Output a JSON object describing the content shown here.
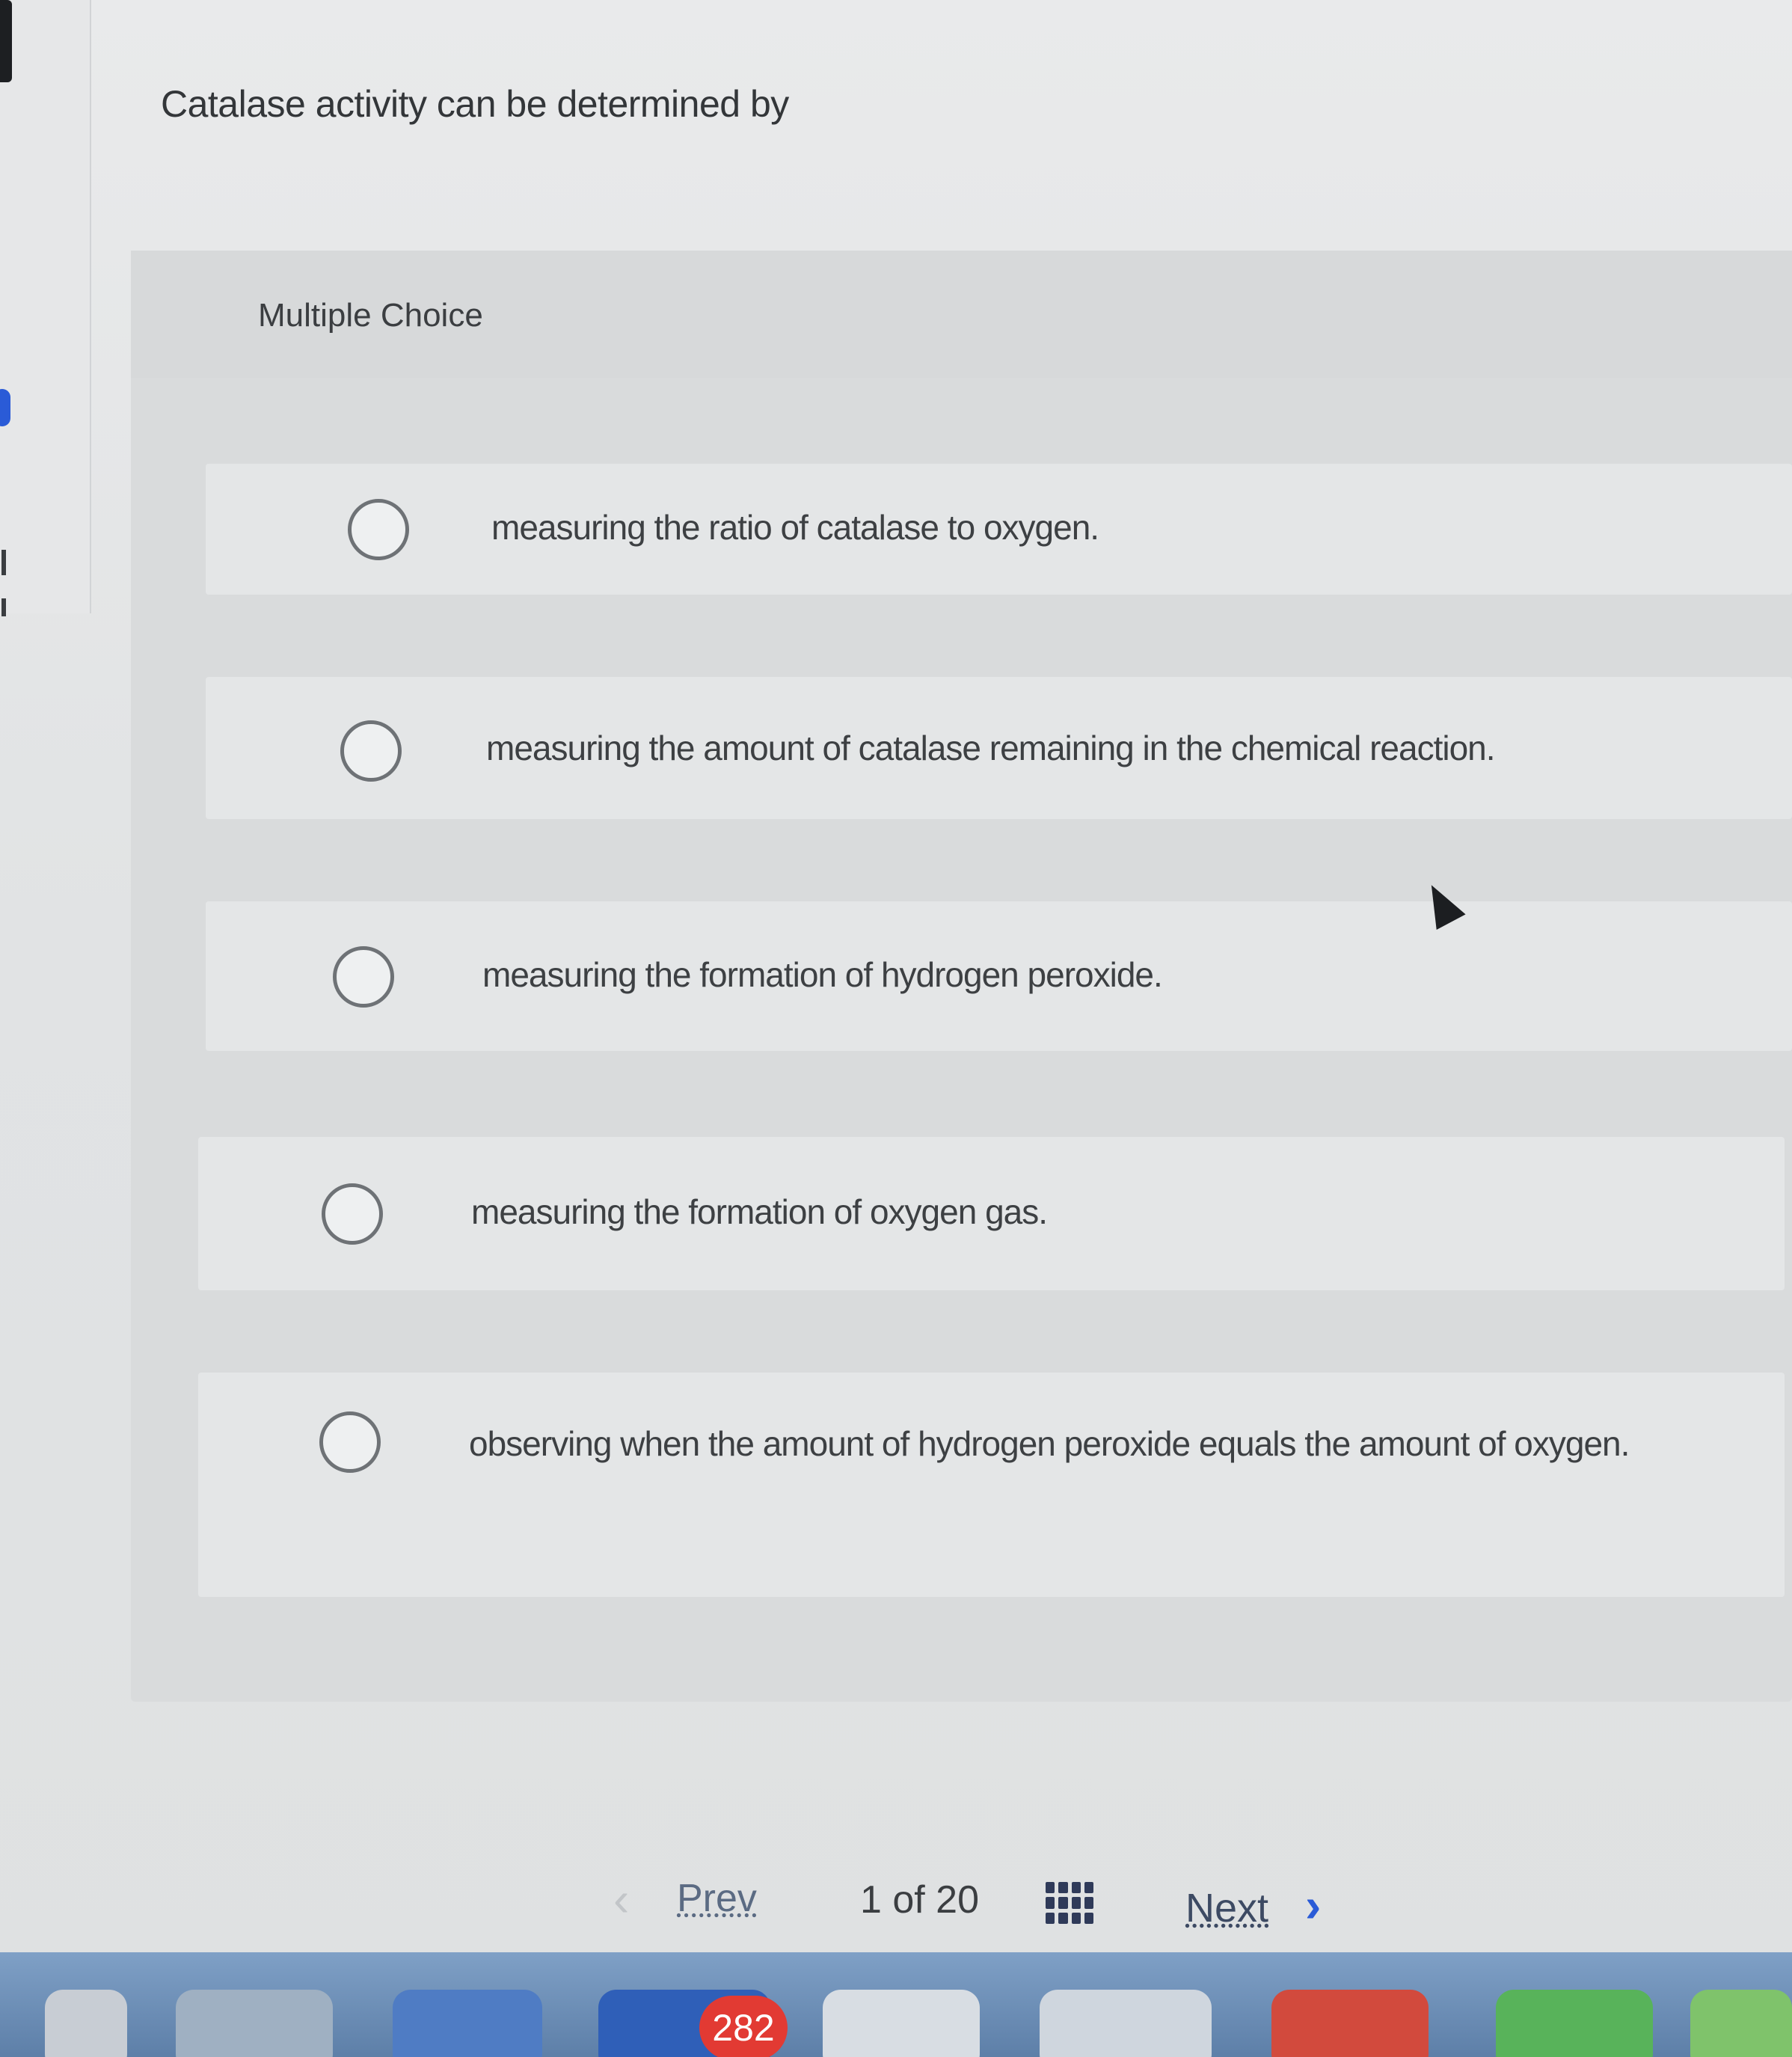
{
  "question": {
    "text": "Catalase activity can be determined by"
  },
  "question_type": "Multiple Choice",
  "options": [
    {
      "label": "measuring the ratio of catalase to oxygen."
    },
    {
      "label": "measuring the amount of catalase remaining in the chemical reaction."
    },
    {
      "label": "measuring the formation of hydrogen peroxide."
    },
    {
      "label": "measuring the formation of oxygen gas."
    },
    {
      "label": "observing when the amount of hydrogen peroxide equals the amount of oxygen."
    }
  ],
  "pagination": {
    "prev_label": "Prev",
    "page_indicator": "1 of 20",
    "next_label": "Next"
  },
  "dock": {
    "badge_count": "282"
  },
  "colors": {
    "accent": "#2a5bd7",
    "badge": "#e23a33"
  }
}
